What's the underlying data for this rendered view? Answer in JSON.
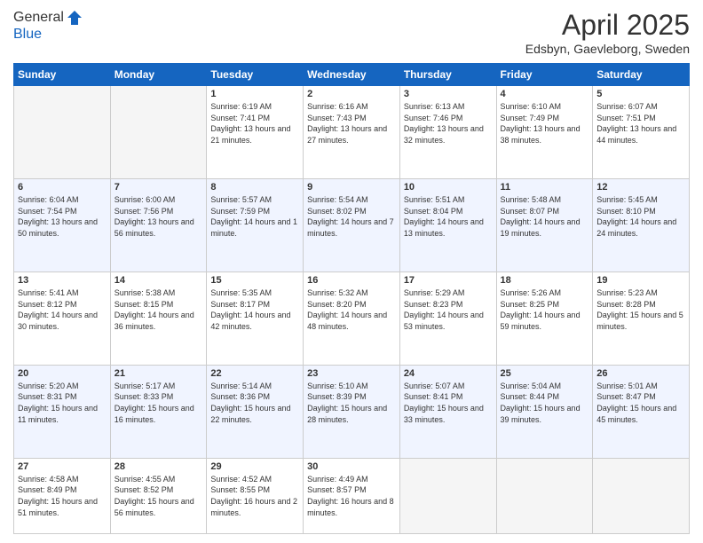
{
  "header": {
    "logo_line1": "General",
    "logo_line2": "Blue",
    "title": "April 2025",
    "location": "Edsbyn, Gaevleborg, Sweden"
  },
  "days_of_week": [
    "Sunday",
    "Monday",
    "Tuesday",
    "Wednesday",
    "Thursday",
    "Friday",
    "Saturday"
  ],
  "weeks": [
    [
      {
        "num": "",
        "info": ""
      },
      {
        "num": "",
        "info": ""
      },
      {
        "num": "1",
        "info": "Sunrise: 6:19 AM\nSunset: 7:41 PM\nDaylight: 13 hours and 21 minutes."
      },
      {
        "num": "2",
        "info": "Sunrise: 6:16 AM\nSunset: 7:43 PM\nDaylight: 13 hours and 27 minutes."
      },
      {
        "num": "3",
        "info": "Sunrise: 6:13 AM\nSunset: 7:46 PM\nDaylight: 13 hours and 32 minutes."
      },
      {
        "num": "4",
        "info": "Sunrise: 6:10 AM\nSunset: 7:49 PM\nDaylight: 13 hours and 38 minutes."
      },
      {
        "num": "5",
        "info": "Sunrise: 6:07 AM\nSunset: 7:51 PM\nDaylight: 13 hours and 44 minutes."
      }
    ],
    [
      {
        "num": "6",
        "info": "Sunrise: 6:04 AM\nSunset: 7:54 PM\nDaylight: 13 hours and 50 minutes."
      },
      {
        "num": "7",
        "info": "Sunrise: 6:00 AM\nSunset: 7:56 PM\nDaylight: 13 hours and 56 minutes."
      },
      {
        "num": "8",
        "info": "Sunrise: 5:57 AM\nSunset: 7:59 PM\nDaylight: 14 hours and 1 minute."
      },
      {
        "num": "9",
        "info": "Sunrise: 5:54 AM\nSunset: 8:02 PM\nDaylight: 14 hours and 7 minutes."
      },
      {
        "num": "10",
        "info": "Sunrise: 5:51 AM\nSunset: 8:04 PM\nDaylight: 14 hours and 13 minutes."
      },
      {
        "num": "11",
        "info": "Sunrise: 5:48 AM\nSunset: 8:07 PM\nDaylight: 14 hours and 19 minutes."
      },
      {
        "num": "12",
        "info": "Sunrise: 5:45 AM\nSunset: 8:10 PM\nDaylight: 14 hours and 24 minutes."
      }
    ],
    [
      {
        "num": "13",
        "info": "Sunrise: 5:41 AM\nSunset: 8:12 PM\nDaylight: 14 hours and 30 minutes."
      },
      {
        "num": "14",
        "info": "Sunrise: 5:38 AM\nSunset: 8:15 PM\nDaylight: 14 hours and 36 minutes."
      },
      {
        "num": "15",
        "info": "Sunrise: 5:35 AM\nSunset: 8:17 PM\nDaylight: 14 hours and 42 minutes."
      },
      {
        "num": "16",
        "info": "Sunrise: 5:32 AM\nSunset: 8:20 PM\nDaylight: 14 hours and 48 minutes."
      },
      {
        "num": "17",
        "info": "Sunrise: 5:29 AM\nSunset: 8:23 PM\nDaylight: 14 hours and 53 minutes."
      },
      {
        "num": "18",
        "info": "Sunrise: 5:26 AM\nSunset: 8:25 PM\nDaylight: 14 hours and 59 minutes."
      },
      {
        "num": "19",
        "info": "Sunrise: 5:23 AM\nSunset: 8:28 PM\nDaylight: 15 hours and 5 minutes."
      }
    ],
    [
      {
        "num": "20",
        "info": "Sunrise: 5:20 AM\nSunset: 8:31 PM\nDaylight: 15 hours and 11 minutes."
      },
      {
        "num": "21",
        "info": "Sunrise: 5:17 AM\nSunset: 8:33 PM\nDaylight: 15 hours and 16 minutes."
      },
      {
        "num": "22",
        "info": "Sunrise: 5:14 AM\nSunset: 8:36 PM\nDaylight: 15 hours and 22 minutes."
      },
      {
        "num": "23",
        "info": "Sunrise: 5:10 AM\nSunset: 8:39 PM\nDaylight: 15 hours and 28 minutes."
      },
      {
        "num": "24",
        "info": "Sunrise: 5:07 AM\nSunset: 8:41 PM\nDaylight: 15 hours and 33 minutes."
      },
      {
        "num": "25",
        "info": "Sunrise: 5:04 AM\nSunset: 8:44 PM\nDaylight: 15 hours and 39 minutes."
      },
      {
        "num": "26",
        "info": "Sunrise: 5:01 AM\nSunset: 8:47 PM\nDaylight: 15 hours and 45 minutes."
      }
    ],
    [
      {
        "num": "27",
        "info": "Sunrise: 4:58 AM\nSunset: 8:49 PM\nDaylight: 15 hours and 51 minutes."
      },
      {
        "num": "28",
        "info": "Sunrise: 4:55 AM\nSunset: 8:52 PM\nDaylight: 15 hours and 56 minutes."
      },
      {
        "num": "29",
        "info": "Sunrise: 4:52 AM\nSunset: 8:55 PM\nDaylight: 16 hours and 2 minutes."
      },
      {
        "num": "30",
        "info": "Sunrise: 4:49 AM\nSunset: 8:57 PM\nDaylight: 16 hours and 8 minutes."
      },
      {
        "num": "",
        "info": ""
      },
      {
        "num": "",
        "info": ""
      },
      {
        "num": "",
        "info": ""
      }
    ]
  ]
}
